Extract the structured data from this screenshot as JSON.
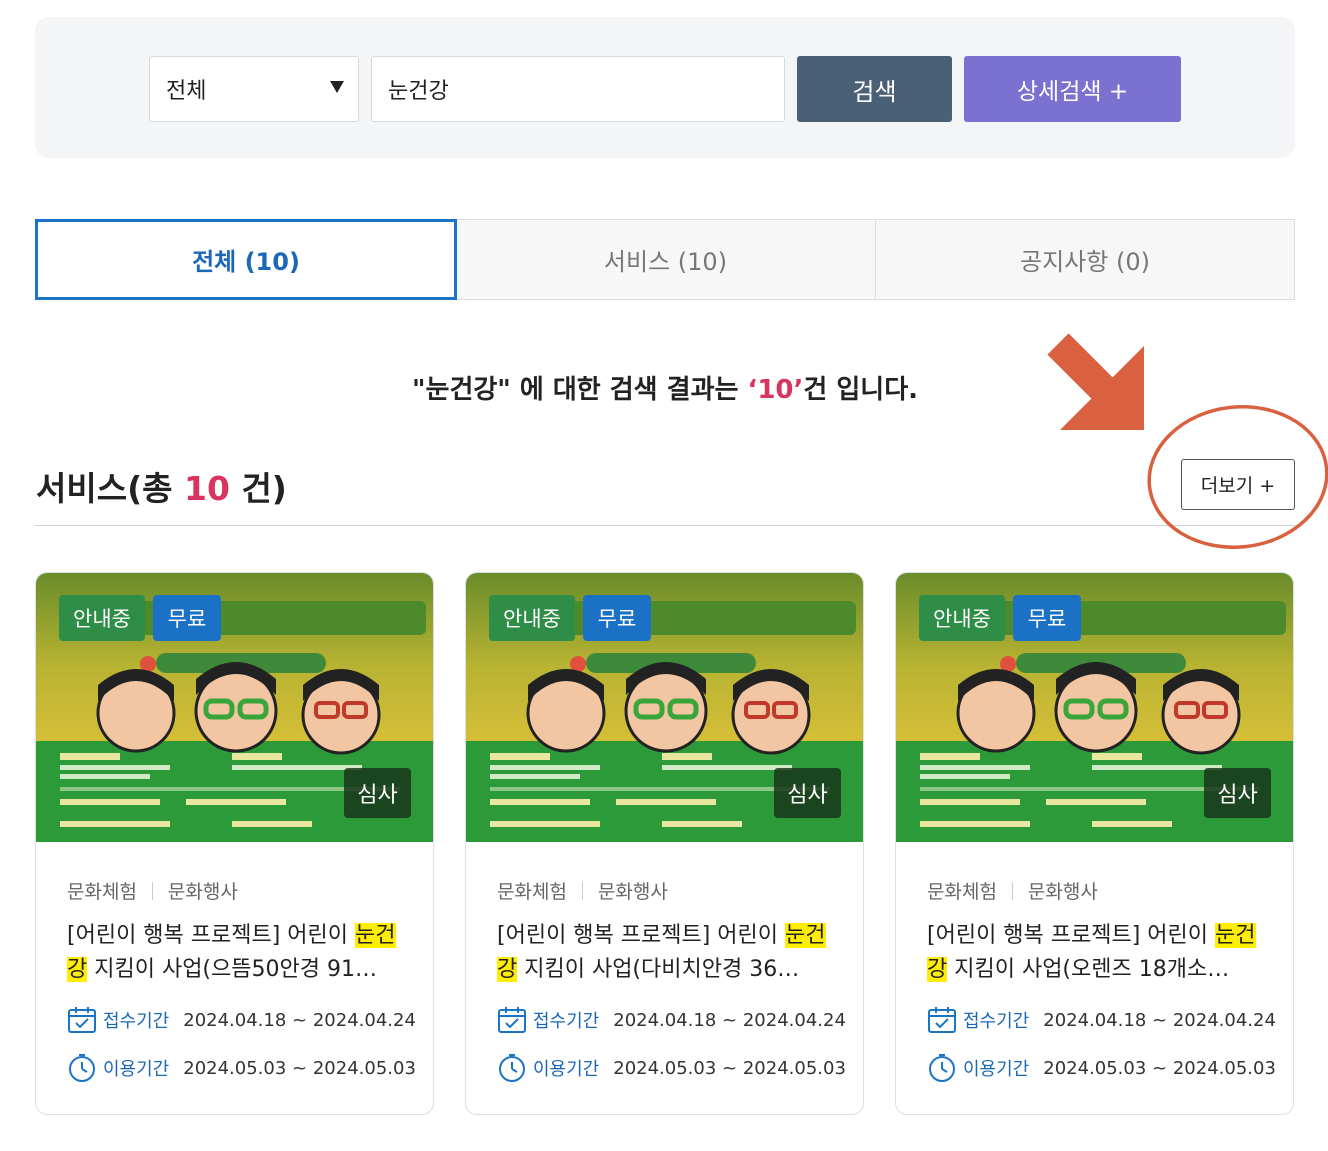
{
  "search": {
    "category": "전체",
    "query": "눈건강",
    "search_button": "검색",
    "advanced_button": "상세검색 +"
  },
  "tabs": [
    {
      "label": "전체 (10)",
      "active": true
    },
    {
      "label": "서비스 (10)",
      "active": false
    },
    {
      "label": "공지사항 (0)",
      "active": false
    }
  ],
  "result_message": {
    "prefix": "\"눈건강\" 에 대한 검색 결과는 ",
    "count": "‘10’",
    "suffix": "건 입니다."
  },
  "section": {
    "title_prefix": "서비스(총 ",
    "count": "10",
    "title_suffix": " 건)",
    "more_button": "더보기 +"
  },
  "colors": {
    "primary_blue": "#1c74c8",
    "accent_red": "#d8345f",
    "annotation_orange": "#d9613f",
    "search_button": "#4a6076",
    "advanced_button": "#7b71d1",
    "highlight": "#ffee00"
  },
  "cards": [
    {
      "badges": [
        "안내중",
        "무료",
        "심사"
      ],
      "categories": [
        "문화체험",
        "문화행사"
      ],
      "title_before": "[어린이 행복 프로젝트] 어린이 ",
      "title_highlight": "눈건강",
      "title_after": " 지킴이 사업(으뜸50안경 91…",
      "apply_label": "접수기간",
      "apply_period": "2024.04.18 ~ 2024.04.24",
      "use_label": "이용기간",
      "use_period": "2024.05.03 ~ 2024.05.03"
    },
    {
      "badges": [
        "안내중",
        "무료",
        "심사"
      ],
      "categories": [
        "문화체험",
        "문화행사"
      ],
      "title_before": "[어린이 행복 프로젝트] 어린이 ",
      "title_highlight": "눈건강",
      "title_after": " 지킴이 사업(다비치안경 36…",
      "apply_label": "접수기간",
      "apply_period": "2024.04.18 ~ 2024.04.24",
      "use_label": "이용기간",
      "use_period": "2024.05.03 ~ 2024.05.03"
    },
    {
      "badges": [
        "안내중",
        "무료",
        "심사"
      ],
      "categories": [
        "문화체험",
        "문화행사"
      ],
      "title_before": "[어린이 행복 프로젝트] 어린이 ",
      "title_highlight": "눈건강",
      "title_after": " 지킴이 사업(오렌즈 18개소…",
      "apply_label": "접수기간",
      "apply_period": "2024.04.18 ~ 2024.04.24",
      "use_label": "이용기간",
      "use_period": "2024.05.03 ~ 2024.05.03"
    }
  ]
}
